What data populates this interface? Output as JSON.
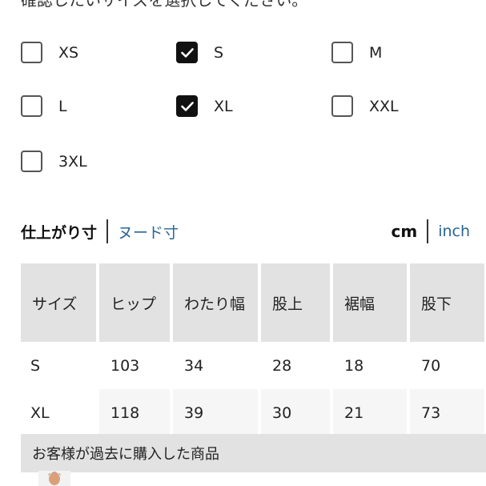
{
  "heading": "確認したいサイズを選択してください。",
  "sizes": [
    {
      "label": "XS",
      "checked": false
    },
    {
      "label": "S",
      "checked": true
    },
    {
      "label": "M",
      "checked": false
    },
    {
      "label": "L",
      "checked": false
    },
    {
      "label": "XL",
      "checked": true
    },
    {
      "label": "XXL",
      "checked": false
    },
    {
      "label": "3XL",
      "checked": false
    }
  ],
  "measure_toggle": {
    "active": "仕上がり寸",
    "other": "ヌード寸"
  },
  "unit_toggle": {
    "active": "cm",
    "other": "inch"
  },
  "table": {
    "headers": [
      "サイズ",
      "ヒップ",
      "わたり幅",
      "股上",
      "裾幅",
      "股下"
    ],
    "rows": [
      [
        "S",
        "103",
        "34",
        "28",
        "18",
        "70"
      ],
      [
        "XL",
        "118",
        "39",
        "30",
        "21",
        "73"
      ]
    ]
  },
  "purchased": {
    "label": "お客様が過去に購入した商品"
  }
}
